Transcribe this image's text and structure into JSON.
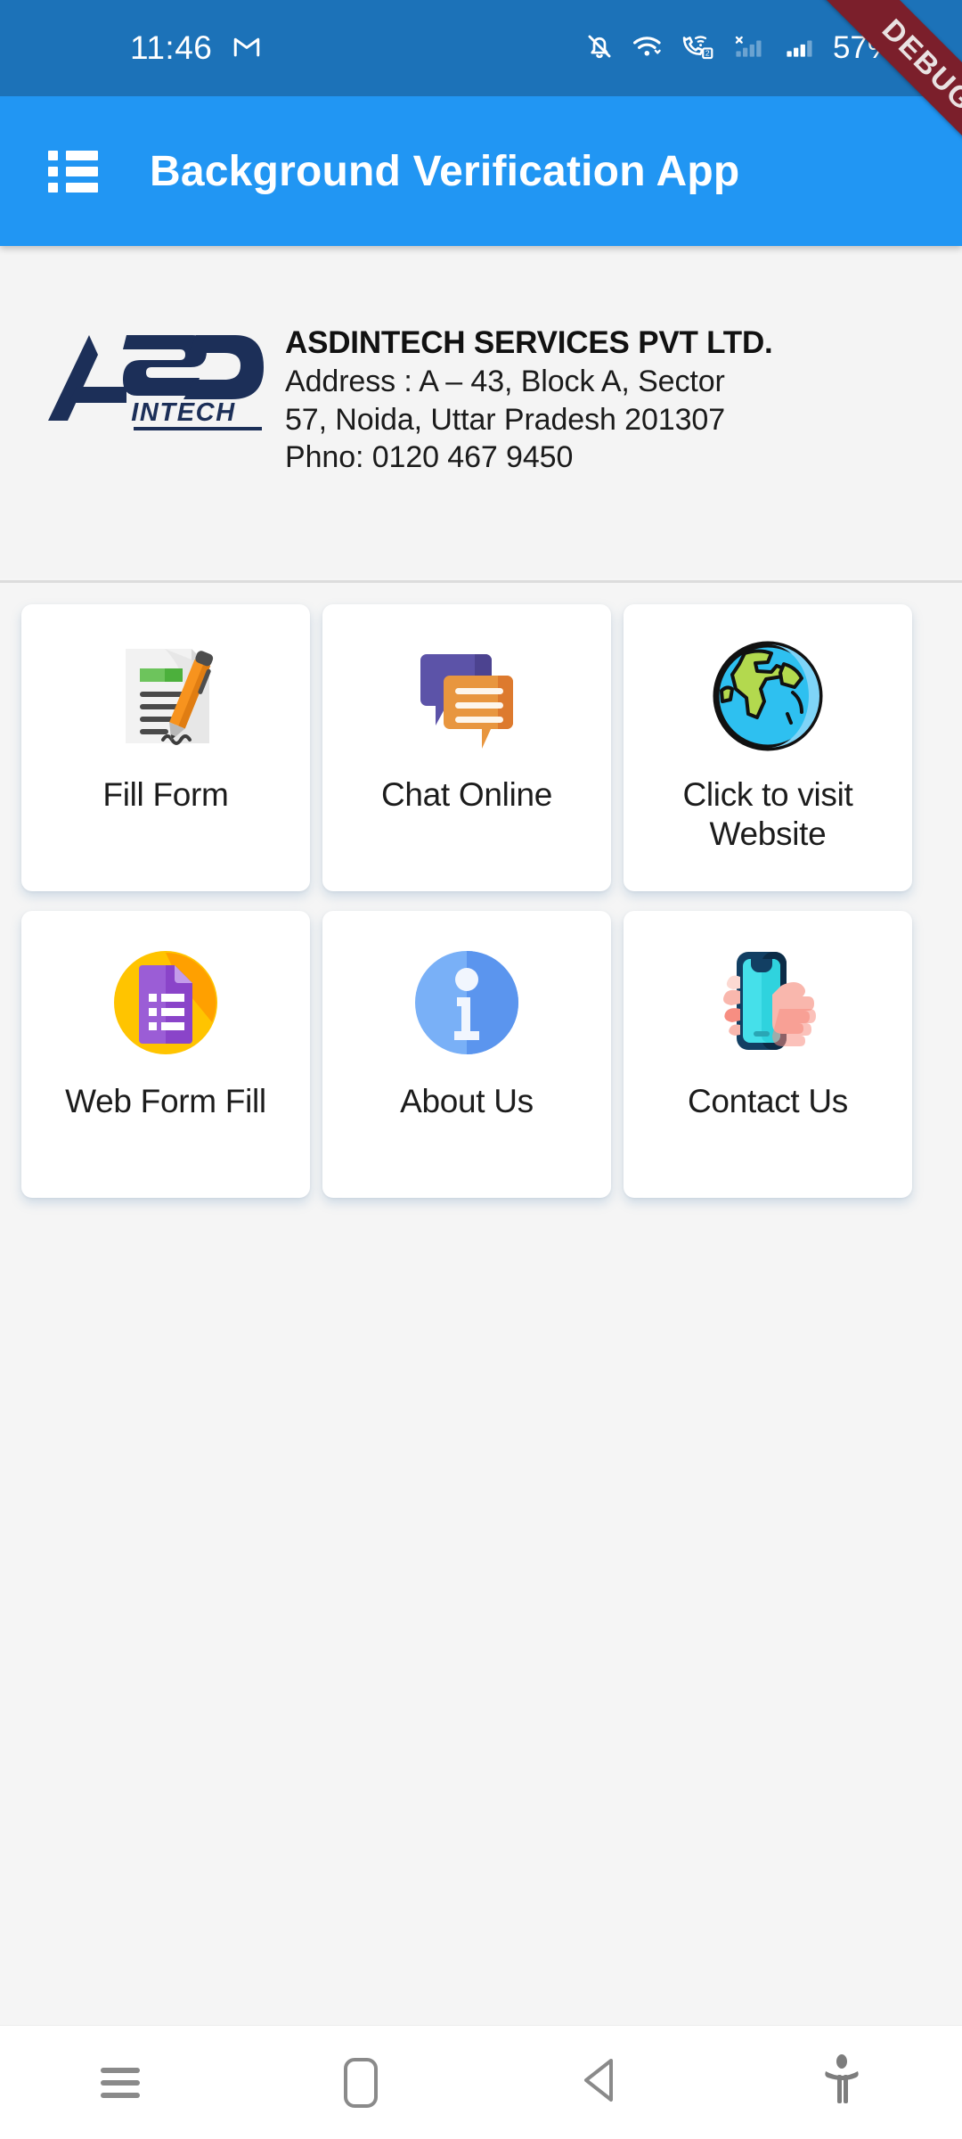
{
  "status_bar": {
    "time": "11:46",
    "battery": "57%",
    "background_color": "#1c72b8",
    "icons": [
      "gmail-m-icon",
      "notifications-off-icon",
      "wifi-icon",
      "vowifi-call-sim2-icon",
      "signal-no-service-icon",
      "signal-bars-icon",
      "battery-charging-icon"
    ]
  },
  "debug_ribbon": {
    "label": "DEBUG",
    "color": "#7b1f2b"
  },
  "app_bar": {
    "title": "Background Verification App",
    "menu_icon": "list-menu-icon",
    "background_color": "#2196f3"
  },
  "company": {
    "logo_primary_text": "ASD",
    "logo_secondary_text": "INTECH",
    "logo_color": "#1c2f58",
    "name": "ASDINTECH SERVICES PVT LTD.",
    "address_line_1": "Address : A – 43, Block A, Sector",
    "address_line_2": "57, Noida, Uttar Pradesh 201307",
    "phone_line": "Phno: 0120 467 9450"
  },
  "tiles": [
    {
      "label": "Fill Form",
      "icon": "document-with-pen-icon"
    },
    {
      "label": "Chat Online",
      "icon": "chat-bubbles-icon"
    },
    {
      "label": "Click to visit Website",
      "icon": "globe-icon"
    },
    {
      "label": "Web Form Fill",
      "icon": "google-forms-icon"
    },
    {
      "label": "About Us",
      "icon": "info-circle-icon"
    },
    {
      "label": "Contact Us",
      "icon": "hand-holding-phone-icon"
    }
  ],
  "bottom_nav": {
    "items": [
      {
        "name": "recents-button",
        "icon": "hamburger-icon"
      },
      {
        "name": "home-button",
        "icon": "home-rounded-square-icon"
      },
      {
        "name": "back-button",
        "icon": "back-triangle-icon"
      },
      {
        "name": "accessibility-button",
        "icon": "accessibility-person-icon"
      }
    ]
  }
}
